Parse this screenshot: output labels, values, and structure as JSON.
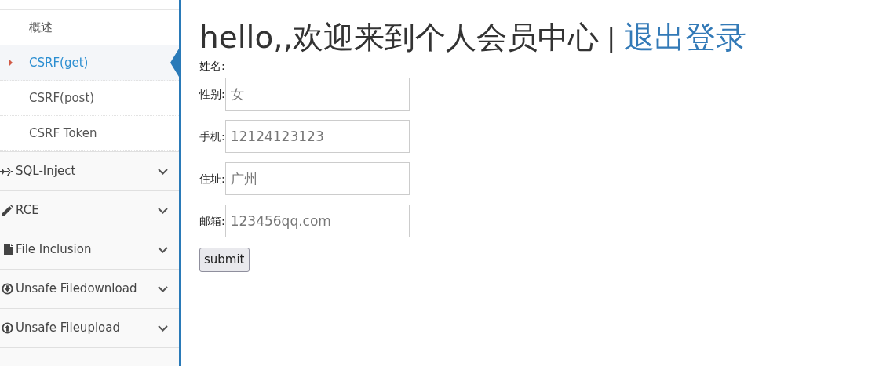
{
  "sidebar": {
    "submenu": [
      {
        "label": "概述",
        "selected": false
      },
      {
        "label": "CSRF(get)",
        "selected": true
      },
      {
        "label": "CSRF(post)",
        "selected": false
      },
      {
        "label": "CSRF Token",
        "selected": false
      }
    ],
    "menu": [
      {
        "label": "SQL-Inject"
      },
      {
        "label": "RCE"
      },
      {
        "label": "File Inclusion"
      },
      {
        "label": "Unsafe Filedownload"
      },
      {
        "label": "Unsafe Fileupload"
      }
    ]
  },
  "main": {
    "greeting": "hello,,欢迎来到个人会员中心",
    "separator": "|",
    "logout_link": "退出登录",
    "form": [
      {
        "kind": "text",
        "label": "姓名:"
      },
      {
        "kind": "input",
        "label": "性别:",
        "value": "女"
      },
      {
        "kind": "input",
        "label": "手机:",
        "value": "12124123123"
      },
      {
        "kind": "input",
        "label": "住址:",
        "value": "广州"
      },
      {
        "kind": "input",
        "label": "邮箱:",
        "value": "123456qq.com"
      }
    ],
    "submit": "submit"
  }
}
